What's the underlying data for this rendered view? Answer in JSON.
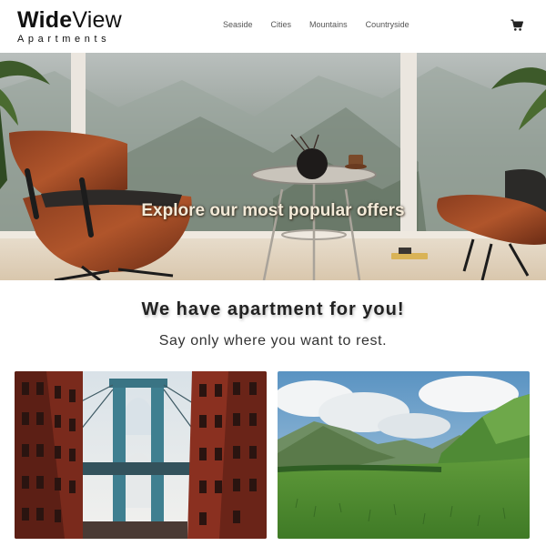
{
  "brand": {
    "name_bold": "Wide",
    "name_light": "View",
    "tagline": "Apartments"
  },
  "nav": {
    "items": [
      {
        "label": "Seaside"
      },
      {
        "label": "Cities"
      },
      {
        "label": "Mountains"
      },
      {
        "label": "Countryside"
      }
    ]
  },
  "icons": {
    "cart": "shopping-cart-icon"
  },
  "hero": {
    "title": "Explore our most popular offers"
  },
  "section": {
    "title": "We have apartment for you!",
    "subtitle": "Say only where you want to rest."
  },
  "colors": {
    "text": "#222222",
    "nav": "#555555",
    "hero_text": "#f3ead8"
  }
}
